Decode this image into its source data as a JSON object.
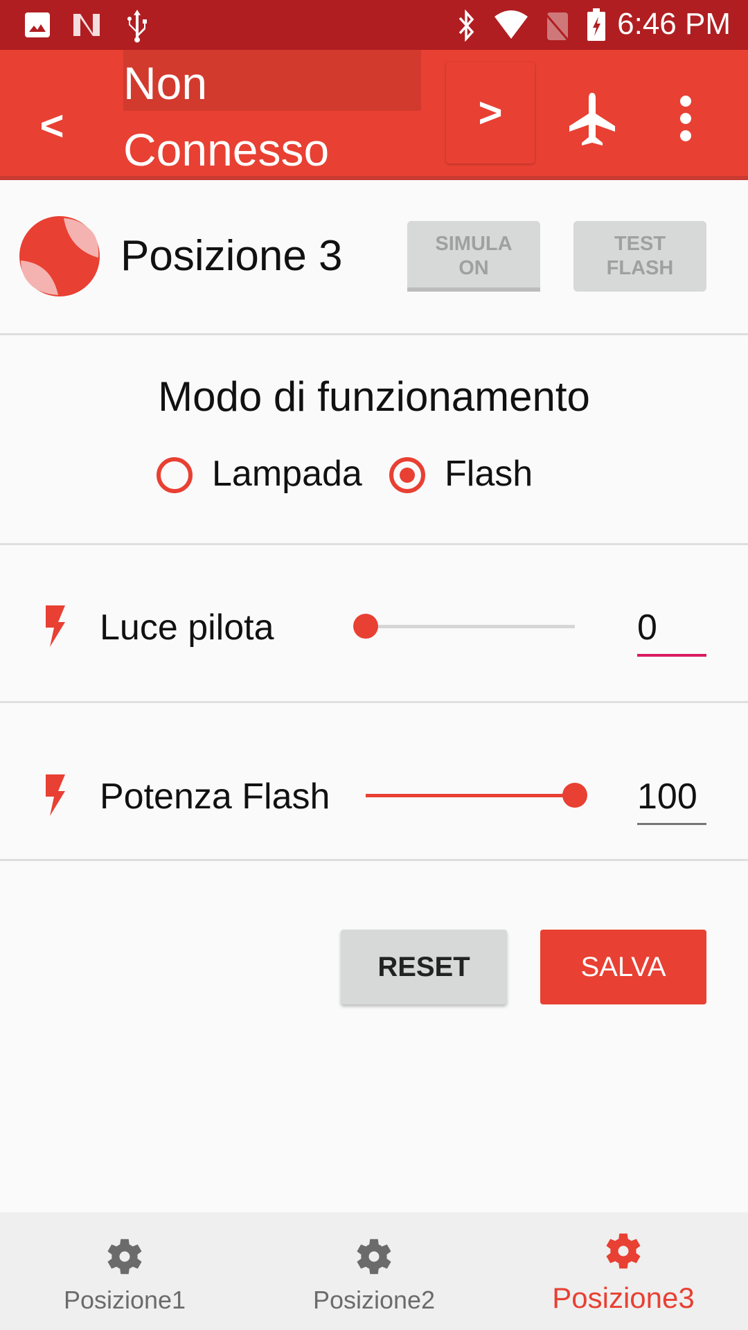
{
  "status_bar": {
    "time": "6:46 PM",
    "left_icons": [
      "image-icon",
      "n-logo-icon",
      "usb-icon"
    ],
    "right_icons": [
      "bluetooth-icon",
      "wifi-icon",
      "no-sim-icon",
      "battery-charging-icon"
    ]
  },
  "app_bar": {
    "title": "Non Connesso",
    "prev_label": "<",
    "next_label": ">",
    "airplane_icon": "airplane-icon",
    "menu_icon": "more-vert-icon"
  },
  "header": {
    "title": "Posizione 3",
    "simula_button": "SIMULA\nON",
    "simula_line1": "SIMULA",
    "simula_line2": "ON",
    "test_line1": "TEST",
    "test_line2": "FLASH"
  },
  "mode": {
    "title": "Modo di funzionamento",
    "options": [
      {
        "label": "Lampada",
        "checked": false
      },
      {
        "label": "Flash",
        "checked": true
      }
    ]
  },
  "sliders": [
    {
      "label": "Luce pilota",
      "value": "0",
      "fraction": 0.0,
      "focused": true
    },
    {
      "label": "Potenza Flash",
      "value": "100",
      "fraction": 1.0,
      "focused": false
    }
  ],
  "actions": {
    "reset": "RESET",
    "save": "SALVA"
  },
  "bottom_nav": {
    "items": [
      {
        "label": "Posizione1",
        "active": false
      },
      {
        "label": "Posizione2",
        "active": false
      },
      {
        "label": "Posizione3",
        "active": true
      }
    ]
  },
  "colors": {
    "status_bar": "#b01e21",
    "primary": "#e84033",
    "accent_underline": "#d81b60",
    "inactive_nav": "#6b6b6b"
  }
}
